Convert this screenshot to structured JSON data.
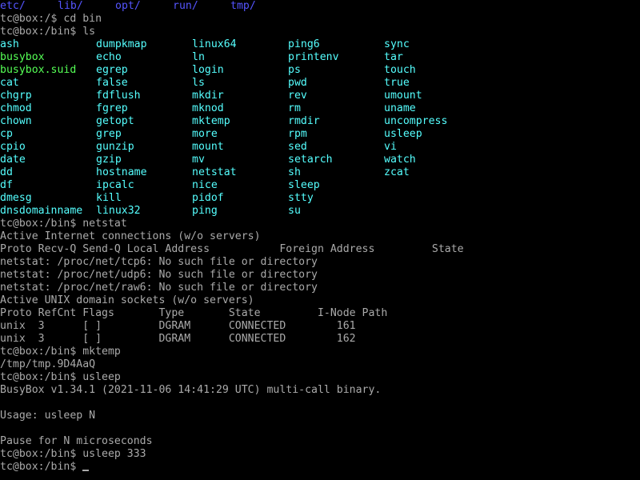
{
  "colors": {
    "background": "#000000",
    "text": "#aaaaaa",
    "directory": "#5555ff",
    "symlink": "#55ffff",
    "executable": "#55ff55"
  },
  "top_dirs": [
    "etc/",
    "lib/",
    "opt/",
    "run/",
    "tmp/"
  ],
  "lines_before_ls": [
    "tc@box:/$ cd bin",
    "tc@box:/bin$ ls"
  ],
  "ls_rows": [
    [
      {
        "t": "ash",
        "k": "link"
      },
      {
        "t": "dumpkmap",
        "k": "link"
      },
      {
        "t": "linux64",
        "k": "link"
      },
      {
        "t": "ping6",
        "k": "link"
      },
      {
        "t": "sync",
        "k": "link"
      }
    ],
    [
      {
        "t": "busybox",
        "k": "exe"
      },
      {
        "t": "echo",
        "k": "link"
      },
      {
        "t": "ln",
        "k": "link"
      },
      {
        "t": "printenv",
        "k": "link"
      },
      {
        "t": "tar",
        "k": "link"
      }
    ],
    [
      {
        "t": "busybox.suid",
        "k": "exe"
      },
      {
        "t": "egrep",
        "k": "link"
      },
      {
        "t": "login",
        "k": "link"
      },
      {
        "t": "ps",
        "k": "link"
      },
      {
        "t": "touch",
        "k": "link"
      }
    ],
    [
      {
        "t": "cat",
        "k": "link"
      },
      {
        "t": "false",
        "k": "link"
      },
      {
        "t": "ls",
        "k": "link"
      },
      {
        "t": "pwd",
        "k": "link"
      },
      {
        "t": "true",
        "k": "link"
      }
    ],
    [
      {
        "t": "chgrp",
        "k": "link"
      },
      {
        "t": "fdflush",
        "k": "link"
      },
      {
        "t": "mkdir",
        "k": "link"
      },
      {
        "t": "rev",
        "k": "link"
      },
      {
        "t": "umount",
        "k": "link"
      }
    ],
    [
      {
        "t": "chmod",
        "k": "link"
      },
      {
        "t": "fgrep",
        "k": "link"
      },
      {
        "t": "mknod",
        "k": "link"
      },
      {
        "t": "rm",
        "k": "link"
      },
      {
        "t": "uname",
        "k": "link"
      }
    ],
    [
      {
        "t": "chown",
        "k": "link"
      },
      {
        "t": "getopt",
        "k": "link"
      },
      {
        "t": "mktemp",
        "k": "link"
      },
      {
        "t": "rmdir",
        "k": "link"
      },
      {
        "t": "uncompress",
        "k": "link"
      }
    ],
    [
      {
        "t": "cp",
        "k": "link"
      },
      {
        "t": "grep",
        "k": "link"
      },
      {
        "t": "more",
        "k": "link"
      },
      {
        "t": "rpm",
        "k": "link"
      },
      {
        "t": "usleep",
        "k": "link"
      }
    ],
    [
      {
        "t": "cpio",
        "k": "link"
      },
      {
        "t": "gunzip",
        "k": "link"
      },
      {
        "t": "mount",
        "k": "link"
      },
      {
        "t": "sed",
        "k": "link"
      },
      {
        "t": "vi",
        "k": "link"
      }
    ],
    [
      {
        "t": "date",
        "k": "link"
      },
      {
        "t": "gzip",
        "k": "link"
      },
      {
        "t": "mv",
        "k": "link"
      },
      {
        "t": "setarch",
        "k": "link"
      },
      {
        "t": "watch",
        "k": "link"
      }
    ],
    [
      {
        "t": "dd",
        "k": "link"
      },
      {
        "t": "hostname",
        "k": "link"
      },
      {
        "t": "netstat",
        "k": "link"
      },
      {
        "t": "sh",
        "k": "link"
      },
      {
        "t": "zcat",
        "k": "link"
      }
    ],
    [
      {
        "t": "df",
        "k": "link"
      },
      {
        "t": "ipcalc",
        "k": "link"
      },
      {
        "t": "nice",
        "k": "link"
      },
      {
        "t": "sleep",
        "k": "link"
      }
    ],
    [
      {
        "t": "dmesg",
        "k": "link"
      },
      {
        "t": "kill",
        "k": "link"
      },
      {
        "t": "pidof",
        "k": "link"
      },
      {
        "t": "stty",
        "k": "link"
      }
    ],
    [
      {
        "t": "dnsdomainname",
        "k": "link"
      },
      {
        "t": "linux32",
        "k": "link"
      },
      {
        "t": "ping",
        "k": "link"
      },
      {
        "t": "su",
        "k": "link"
      }
    ]
  ],
  "lines_after_ls": [
    "tc@box:/bin$ netstat",
    "Active Internet connections (w/o servers)",
    "Proto Recv-Q Send-Q Local Address           Foreign Address         State",
    "netstat: /proc/net/tcp6: No such file or directory",
    "netstat: /proc/net/udp6: No such file or directory",
    "netstat: /proc/net/raw6: No such file or directory",
    "Active UNIX domain sockets (w/o servers)",
    "Proto RefCnt Flags       Type       State         I-Node Path",
    "unix  3      [ ]         DGRAM      CONNECTED        161",
    "unix  3      [ ]         DGRAM      CONNECTED        162",
    "tc@box:/bin$ mktemp",
    "/tmp/tmp.9D4AaQ",
    "tc@box:/bin$ usleep",
    "BusyBox v1.34.1 (2021-11-06 14:41:29 UTC) multi-call binary.",
    "",
    "Usage: usleep N",
    "",
    "Pause for N microseconds",
    "tc@box:/bin$ usleep 333"
  ],
  "prompt": "tc@box:/bin$"
}
